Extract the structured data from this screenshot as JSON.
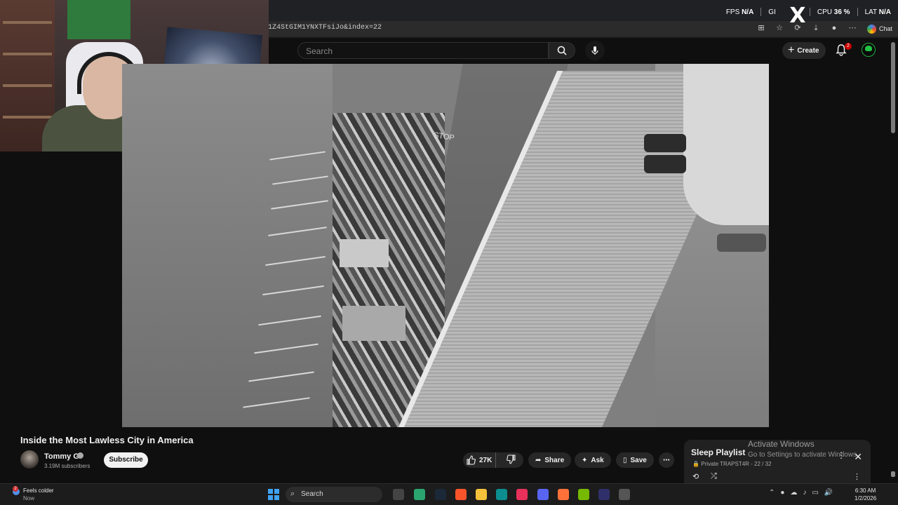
{
  "browser": {
    "url": "1Z4StGIM1YNXTFsiJo&index=22",
    "chat_label": "Chat"
  },
  "perf_overlay": {
    "fps_label": "FPS",
    "fps_value": "N/A",
    "gpu_label": "GI",
    "cpu_label": "CPU",
    "cpu_value": "36 %",
    "lat_label": "LAT",
    "lat_value": "N/A"
  },
  "youtube_header": {
    "search_placeholder": "Search",
    "create_label": "Create",
    "notification_count": "2"
  },
  "video": {
    "stop_marking": "STOP",
    "title": "Inside the Most Lawless City in America"
  },
  "channel": {
    "name": "Tommy G",
    "subscribers": "3.19M subscribers",
    "subscribe_label": "Subscribe"
  },
  "actions": {
    "likes": "27K",
    "share_label": "Share",
    "ask_label": "Ask",
    "save_label": "Save"
  },
  "playlist": {
    "title": "Sleep Playlist",
    "meta": "Private TRAPST4R - 22 / 32"
  },
  "windows_watermark": {
    "title": "Activate Windows",
    "subtitle": "Go to Settings to activate Windows."
  },
  "taskbar": {
    "weather_text": "Feels colder",
    "weather_sub": "Now",
    "weather_badge": "2",
    "search_label": "Search",
    "time": "6:30 AM",
    "date": "1/2/2026"
  },
  "colors": {
    "youtube_bg": "#0f0f0f",
    "notification_red": "#cc0000",
    "windows_blue": "#3fa3f5"
  }
}
